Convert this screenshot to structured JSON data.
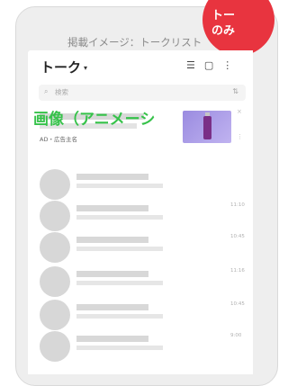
{
  "caption": "掲載イメージ：トークリスト",
  "badge": {
    "line1": "トー",
    "line2": "のみ"
  },
  "header": {
    "title": "トーク",
    "caret": "▾"
  },
  "search": {
    "placeholder": "検索"
  },
  "ad": {
    "label": "AD・広告主名",
    "close": "×"
  },
  "overlay": "画像（アニメーシ",
  "rows": [
    {
      "time": ""
    },
    {
      "time": "11:10"
    },
    {
      "time": "10:45"
    },
    {
      "time": "11:16"
    },
    {
      "time": "10:45"
    },
    {
      "time": "9:00"
    }
  ],
  "colors": {
    "badge": "#e8343f",
    "overlay": "#36c24a",
    "skeleton": "#d8d8d8"
  },
  "icons": [
    "sort-icon",
    "chat-icon",
    "more-icon",
    "search-icon",
    "filter-icon"
  ]
}
